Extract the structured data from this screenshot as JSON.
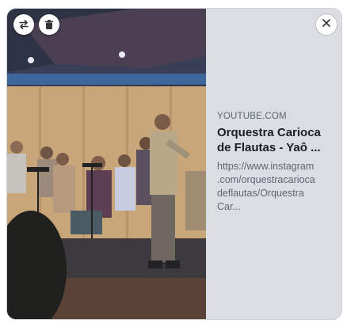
{
  "link_preview": {
    "domain": "YOUTUBE.COM",
    "title_line1": "Orquestra Carioca",
    "title_line2": "de Flautas - Yaô ...",
    "description_lines": [
      "https://www.instagram",
      ".com/orquestracarioca",
      "deflautas/Orquestra",
      "Car..."
    ]
  },
  "controls": {
    "swap_icon": "swap-arrows-icon",
    "trash_icon": "trash-icon",
    "close_icon": "close-icon"
  },
  "colors": {
    "panel_bg": "#dadde1",
    "title": "#1c1e21",
    "muted": "#606770"
  }
}
